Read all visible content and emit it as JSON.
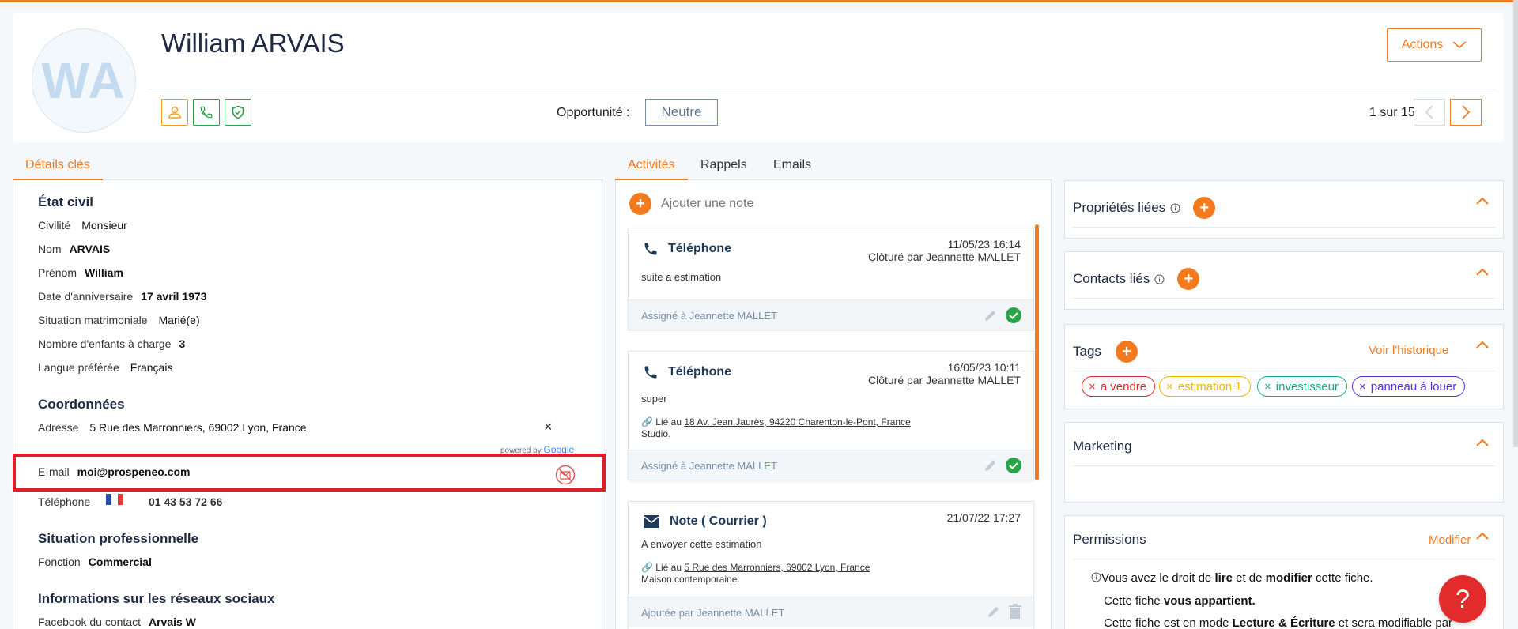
{
  "header": {
    "avatar_initials": "WA",
    "name": "William ARVAIS",
    "actions_label": "Actions",
    "opportunity_label": "Opportunité :",
    "opportunity_value": "Neutre",
    "pager": "1 sur 15"
  },
  "left_tabs": {
    "details": "Détails clés"
  },
  "etat_civil": {
    "title": "État civil",
    "civilite_label": "Civilité",
    "civilite_value": "Monsieur",
    "nom_label": "Nom",
    "nom_value": "ARVAIS",
    "prenom_label": "Prénom",
    "prenom_value": "William",
    "anniv_label": "Date d'anniversaire",
    "anniv_value": "17 avril 1973",
    "situation_label": "Situation matrimoniale",
    "situation_value": "Marié(e)",
    "enfants_label": "Nombre d'enfants à charge",
    "enfants_value": "3",
    "langue_label": "Langue préférée",
    "langue_value": "Français"
  },
  "coordonnees": {
    "title": "Coordonnées",
    "adresse_label": "Adresse",
    "adresse_value": "5 Rue des Marronniers, 69002 Lyon, France",
    "clear": "×",
    "powered_by": "powered by",
    "google": "Google",
    "email_label": "E-mail",
    "email_value": "moi@prospeneo.com",
    "tel_label": "Téléphone",
    "tel_value": "01 43 53 72 66"
  },
  "situation_pro": {
    "title": "Situation professionnelle",
    "fonction_label": "Fonction",
    "fonction_value": "Commercial"
  },
  "reseaux": {
    "title": "Informations sur les réseaux sociaux",
    "facebook_label": "Facebook du contact",
    "facebook_value": "Arvais W"
  },
  "mid_tabs": {
    "activites": "Activités",
    "rappels": "Rappels",
    "emails": "Emails"
  },
  "add_note": "Ajouter une note",
  "activities": [
    {
      "title": "Téléphone",
      "date": "11/05/23 16:14",
      "closed_by": "Clôturé par Jeannette MALLET",
      "text": "suite a estimation",
      "footer": "Assigné à Jeannette MALLET"
    },
    {
      "title": "Téléphone",
      "date": "16/05/23 10:11",
      "closed_by": "Clôturé par Jeannette MALLET",
      "text": "super",
      "link_prefix": "Lié au",
      "link": "18 Av. Jean Jaurès, 94220 Charenton-le-Pont, France",
      "link_sub": "Studio.",
      "footer": "Assigné à Jeannette MALLET"
    },
    {
      "title": "Note ( Courrier )",
      "date": "21/07/22 17:27",
      "text": "A envoyer cette estimation",
      "link_prefix": "Lié au",
      "link": "5 Rue des Marronniers, 69002 Lyon, France",
      "link_sub": "Maison contemporaine.",
      "footer": "Ajoutée par Jeannette MALLET"
    }
  ],
  "panels": {
    "proprietes": "Propriétés liées",
    "contacts": "Contacts liés",
    "tags": "Tags",
    "tags_history": "Voir l'historique",
    "marketing": "Marketing",
    "permissions": "Permissions",
    "permissions_edit": "Modifier"
  },
  "tags": [
    {
      "label": "a vendre",
      "color": "#e02b2b"
    },
    {
      "label": "estimation 1",
      "color": "#f2b705"
    },
    {
      "label": "investisseur",
      "color": "#19a98a"
    },
    {
      "label": "panneau à louer",
      "color": "#5a2ee0"
    }
  ],
  "permissions_text": {
    "l1_a": "Vous avez le droit de ",
    "l1_b": "lire",
    "l1_c": " et de ",
    "l1_d": "modifier",
    "l1_e": " cette fiche.",
    "l2_a": "Cette fiche ",
    "l2_b": "vous appartient.",
    "l3_a": "Cette fiche est en mode ",
    "l3_b": "Lecture & Écriture",
    "l3_c": " et sera modifiable par"
  },
  "help": "?"
}
